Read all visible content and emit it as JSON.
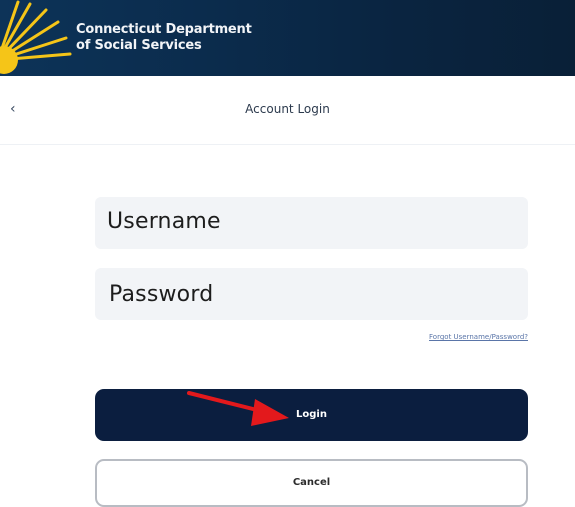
{
  "header": {
    "title_line1": "Connecticut Department",
    "title_line2": "of Social Services"
  },
  "subnav": {
    "back_icon": "chevron-left-icon",
    "title": "Account Login"
  },
  "form": {
    "username_placeholder": "Username",
    "password_placeholder": "Password",
    "forgot_link": "Forgot Username/Password?"
  },
  "buttons": {
    "login_label": "Login",
    "cancel_label": "Cancel"
  },
  "annotation": {
    "icon": "red-arrow-icon",
    "color": "#e3191c"
  },
  "colors": {
    "brand_navy": "#0b1e3f",
    "header_blue": "#0d3358",
    "sun_yellow": "#f5c518"
  }
}
